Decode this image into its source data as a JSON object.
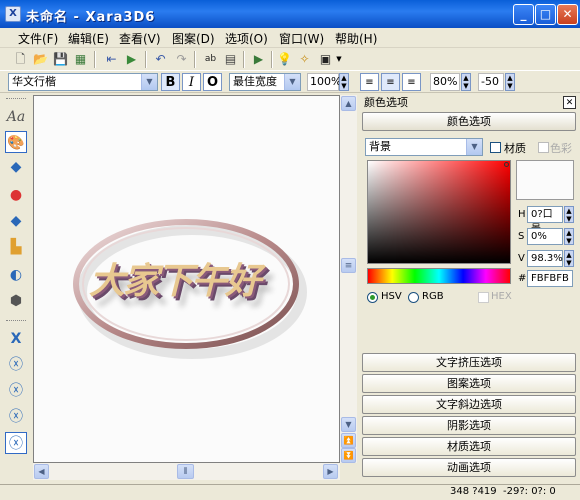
{
  "window": {
    "title": "未命名 - Xara3D6",
    "app_icon": "X"
  },
  "menu": [
    "文件(F)",
    "编辑(E)",
    "查看(V)",
    "图案(D)",
    "选项(O)",
    "窗口(W)",
    "帮助(H)"
  ],
  "format_bar": {
    "font": "华文行楷",
    "bold": "B",
    "italic": "I",
    "outline": "O",
    "width_mode": "最佳宽度",
    "size": "100%",
    "line_spacing": "80%",
    "spacing": "-50"
  },
  "canvas": {
    "text": "大家下午好"
  },
  "panel": {
    "title": "颜色选项",
    "section_button": "颜色选项",
    "target_select": "背景",
    "material_label": "材质",
    "color_label": "色彩",
    "hsv": {
      "h_label": "H",
      "h_value": "0?口景",
      "s_label": "S",
      "s_value": "0%",
      "v_label": "V",
      "v_value": "98.3%",
      "hex_label": "#",
      "hex_value": "FBFBFB"
    },
    "mode_hsv": "HSV",
    "mode_rgb": "RGB",
    "mode_hex": "HEX",
    "buttons": [
      "文字挤压选项",
      "图案选项",
      "文字斜边选项",
      "阴影选项",
      "材质选项",
      "动画选项"
    ]
  },
  "status": {
    "coords": "348 ?419",
    "rotation": "-29?: 0?: 0"
  },
  "colors": {
    "title_bar": "#0a5fd8",
    "selection": "#316ac5",
    "bg": "#ece9d8"
  }
}
